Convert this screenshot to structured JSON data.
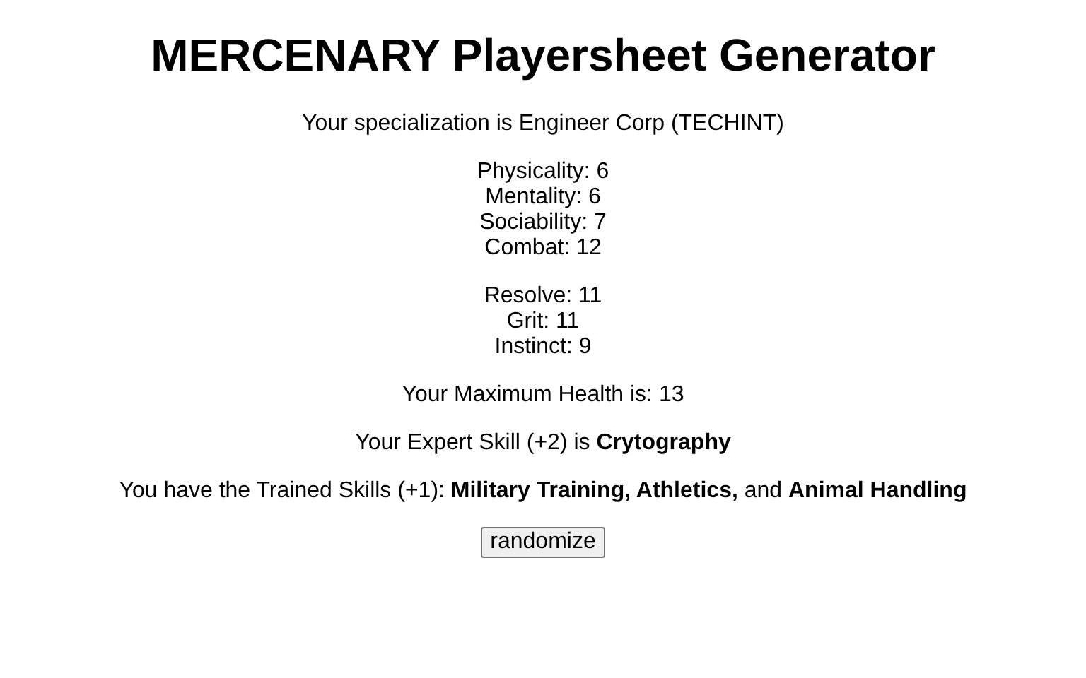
{
  "title": "MERCENARY Playersheet Generator",
  "specialization": "Your specialization is Engineer Corp (TECHINT)",
  "stat_groups": [
    [
      "Physicality: 6",
      "Mentality: 6",
      "Sociability: 7",
      "Combat: 12"
    ],
    [
      "Resolve: 11",
      "Grit: 11",
      "Instinct: 9"
    ]
  ],
  "health": "Your Maximum Health is: 13",
  "expert_skill": "Your Expert Skill (+2) is **Crytography**",
  "trained_skills": "You have the Trained Skills (+1): **Military Training, Athletics,** and **Animal Handling**",
  "button": "randomize"
}
